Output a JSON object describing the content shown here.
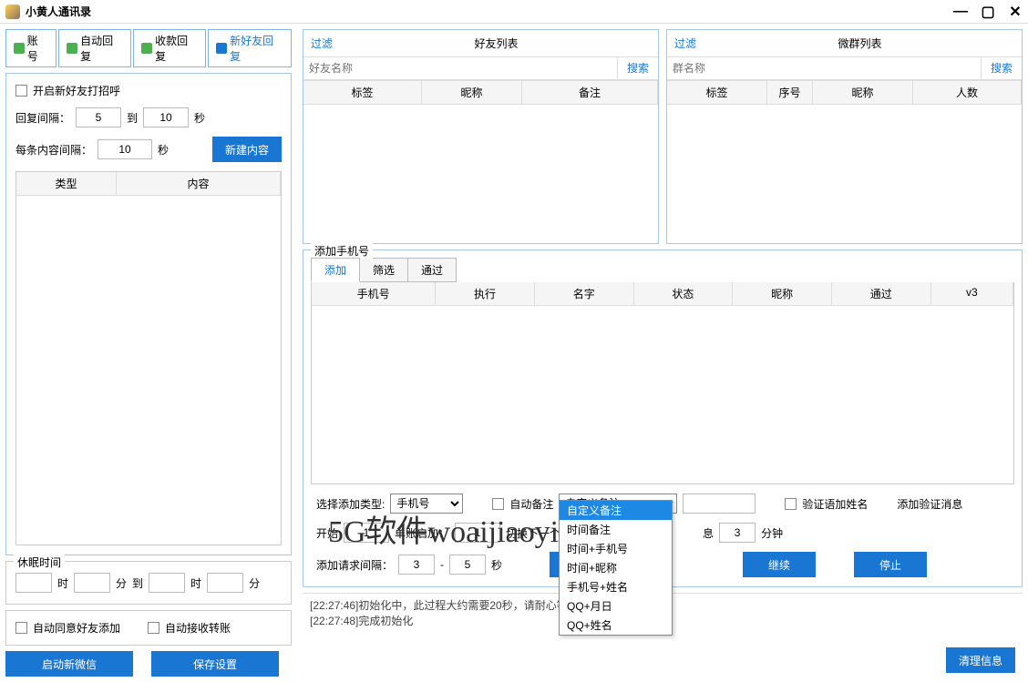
{
  "title": "小黄人通讯录",
  "tabs": {
    "t0": "账号",
    "t1": "自动回复",
    "t2": "收款回复",
    "t3": "新好友回复"
  },
  "newfriend": {
    "enable": "开启新好友打招呼",
    "interval_lbl": "回复间隔：",
    "interval_from": "5",
    "to": "到",
    "interval_to": "10",
    "sec": "秒",
    "content_interval_lbl": "每条内容间隔：",
    "content_interval": "10",
    "newcontent": "新建内容",
    "col_type": "类型",
    "col_content": "内容"
  },
  "sleep": {
    "legend": "休眠时间",
    "hour": "时",
    "min": "分",
    "to": "到"
  },
  "auto": {
    "agree": "自动同意好友添加",
    "recv": "自动接收转账"
  },
  "btns": {
    "launch": "启动新微信",
    "save": "保存设置"
  },
  "friendlist": {
    "filter": "过滤",
    "title": "好友列表",
    "search_ph": "好友名称",
    "search": "搜索",
    "c0": "标签",
    "c1": "昵称",
    "c2": "备注"
  },
  "grouplist": {
    "filter": "过滤",
    "title": "微群列表",
    "search_ph": "群名称",
    "search": "搜索",
    "c0": "标签",
    "c1": "序号",
    "c2": "昵称",
    "c3": "人数"
  },
  "addphone": {
    "legend": "添加手机号",
    "tab0": "添加",
    "tab1": "筛选",
    "tab2": "通过",
    "col0": "手机号",
    "col1": "执行",
    "col2": "名字",
    "col3": "状态",
    "col4": "昵称",
    "col5": "通过",
    "col6": "v3",
    "selecttype": "选择添加类型:",
    "phone": "手机号",
    "autoremark": "自动备注",
    "remark_sel": "自定义备注",
    "verifyname": "验证语加姓名",
    "addverify": "添加验证消息",
    "start": "开始",
    "start_v": "1",
    "single": "单账启加：",
    "single_v": "1",
    "switch": "切换下一个账号",
    "rest1": "息",
    "rest_v": "3",
    "rest_min": "分钟",
    "reqint": "添加请求间隔：",
    "req_from": "3",
    "dash": "-",
    "req_to": "5",
    "sec": "秒",
    "btn_start": "开始",
    "btn_continue": "继续",
    "btn_stop": "停止"
  },
  "dropdown": {
    "o0": "自定义备注",
    "o1": "时间备注",
    "o2": "时间+手机号",
    "o3": "时间+昵称",
    "o4": "手机号+姓名",
    "o5": "QQ+月日",
    "o6": "QQ+姓名"
  },
  "log": {
    "l0": "[22:27:46]初始化中，此过程大约需要20秒，请耐心等待...",
    "l1": "[22:27:48]完成初始化"
  },
  "clear": "清理信息",
  "watermark": "5G软件woaijiaoyi.cn"
}
